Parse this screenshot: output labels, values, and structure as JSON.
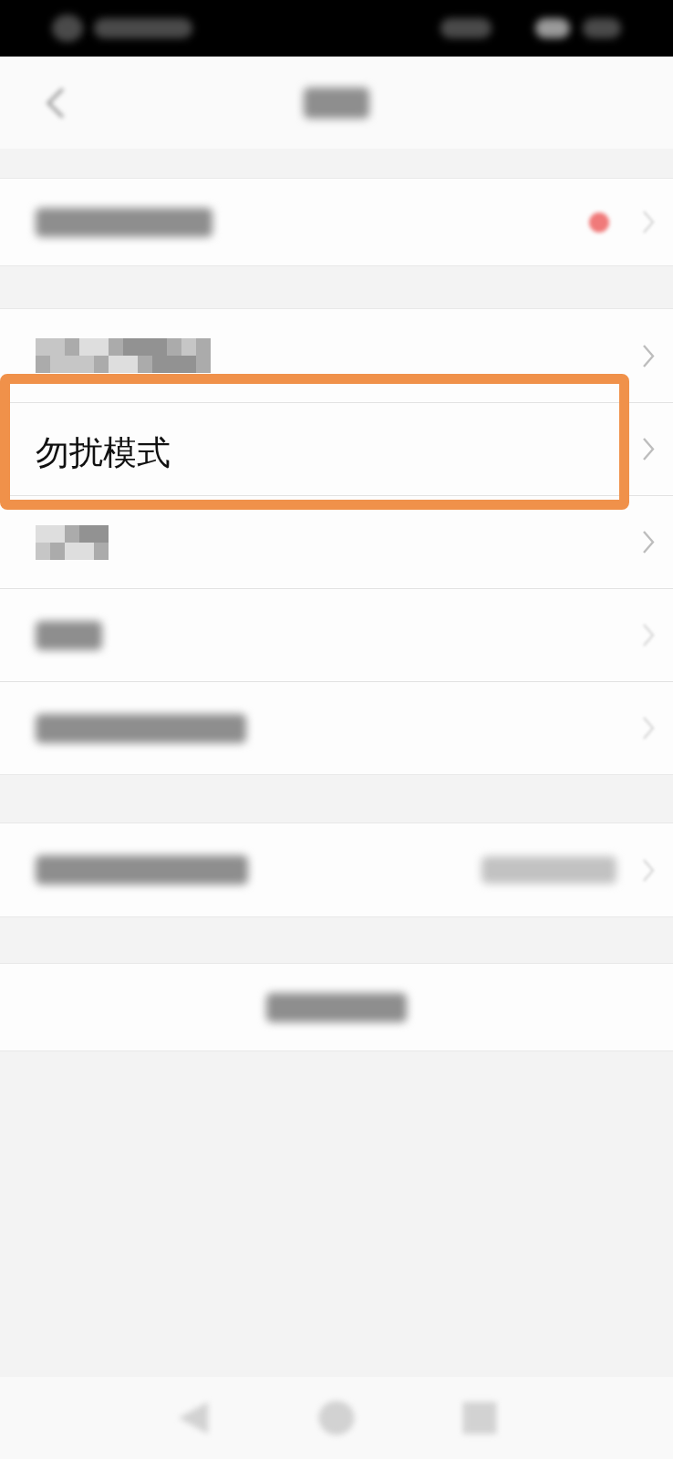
{
  "header": {
    "back": true,
    "title": {
      "kind": "blurred"
    }
  },
  "sections": [
    {
      "rows": [
        {
          "kind": "blurred",
          "dot": true,
          "chevron": true,
          "highlighted": false
        }
      ]
    },
    {
      "rows": [
        {
          "kind": "pixelated",
          "dot": false,
          "chevron": true,
          "highlighted": false
        },
        {
          "kind": "text",
          "label": "勿扰模式",
          "dot": false,
          "chevron": true,
          "highlighted": true
        },
        {
          "kind": "pixelated",
          "dot": false,
          "chevron": true,
          "highlighted": false
        },
        {
          "kind": "blurred",
          "dot": false,
          "chevron": true,
          "highlighted": false
        },
        {
          "kind": "blurred",
          "dot": false,
          "chevron": true,
          "highlighted": false
        }
      ]
    },
    {
      "rows": [
        {
          "kind": "detailed",
          "dot": false,
          "chevron": true,
          "highlighted": false
        }
      ]
    },
    {
      "rows": [
        {
          "kind": "centered",
          "dot": false,
          "chevron": false,
          "highlighted": false
        }
      ]
    }
  ]
}
